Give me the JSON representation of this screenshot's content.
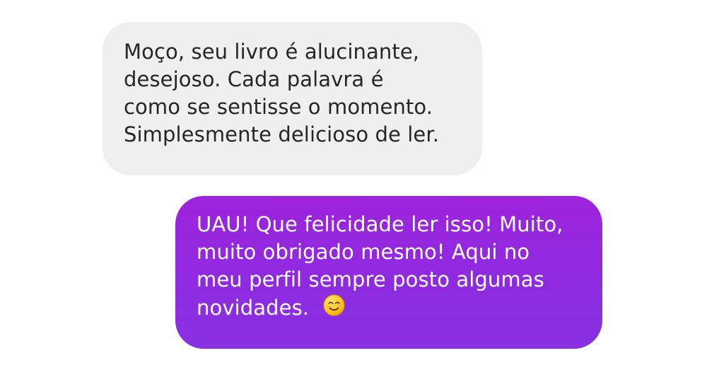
{
  "conversation": {
    "messages": [
      {
        "direction": "incoming",
        "lines": [
          "Moço, seu livro é alucinante,",
          "desejoso. Cada palavra é",
          "como se sentisse o momento.",
          "Simplesmente delicioso de ler."
        ]
      },
      {
        "direction": "outgoing",
        "lines": [
          "UAU! Que felicidade ler isso! Muito,",
          "muito obrigado mesmo! Aqui no",
          "meu perfil sempre posto algumas",
          "novidades."
        ],
        "emoji": "smile-icon"
      }
    ]
  },
  "colors": {
    "incoming_bubble": "#efefef",
    "outgoing_bubble_top": "#9d23dc",
    "outgoing_bubble_bottom": "#8832e2",
    "incoming_text": "#262626",
    "outgoing_text": "#ffffff"
  }
}
